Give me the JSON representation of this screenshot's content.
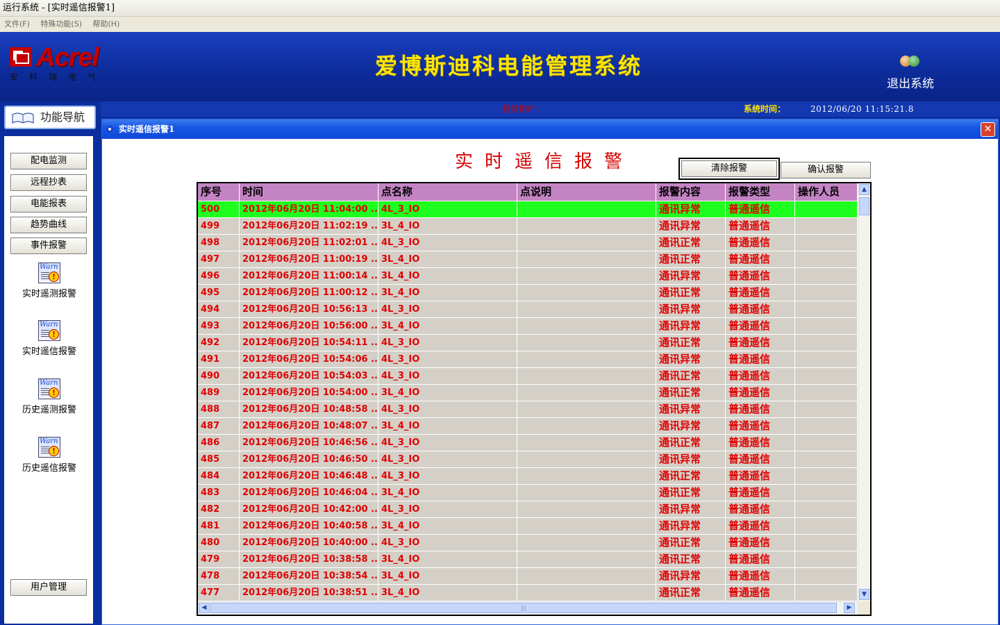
{
  "window": {
    "title": "运行系统 - [实时遥信报警1]"
  },
  "menu": [
    "文件(F)",
    "特殊功能(S)",
    "帮助(H)"
  ],
  "header": {
    "brand": "Acrel",
    "brand_sub": "安科瑞电气",
    "app_title": "爱博斯迪科电能管理系统",
    "exit_label": "退出系统"
  },
  "status": {
    "login_label": "登陆用户：",
    "systime_label": "系统时间：",
    "systime_value": "2012/06/20   11:15:21.8"
  },
  "nav": {
    "title": "功能导航",
    "buttons": [
      "配电监测",
      "远程抄表",
      "电能报表",
      "趋势曲线",
      "事件报警"
    ],
    "icons": [
      "实时遥测报警",
      "实时遥信报警",
      "历史遥测报警",
      "历史遥信报警"
    ],
    "user_mgmt": "用户管理"
  },
  "panel": {
    "title": "实时遥信报警1",
    "close": "✕",
    "heading": "实时遥信报警",
    "clear_button": "清除报警",
    "confirm_button": "确认报警"
  },
  "table": {
    "columns": [
      "序号",
      "时间",
      "点名称",
      "点说明",
      "报警内容",
      "报警类型",
      "操作人员"
    ],
    "rows": [
      [
        "500",
        "2012年06月20日 11:04:00 ...",
        "4L_3_IO",
        "",
        "通讯异常",
        "普通遥信",
        ""
      ],
      [
        "499",
        "2012年06月20日 11:02:19 ...",
        "3L_4_IO",
        "",
        "通讯异常",
        "普通遥信",
        ""
      ],
      [
        "498",
        "2012年06月20日 11:02:01 ...",
        "4L_3_IO",
        "",
        "通讯正常",
        "普通遥信",
        ""
      ],
      [
        "497",
        "2012年06月20日 11:00:19 ...",
        "3L_4_IO",
        "",
        "通讯正常",
        "普通遥信",
        ""
      ],
      [
        "496",
        "2012年06月20日 11:00:14 ...",
        "3L_4_IO",
        "",
        "通讯异常",
        "普通遥信",
        ""
      ],
      [
        "495",
        "2012年06月20日 11:00:12 ...",
        "3L_4_IO",
        "",
        "通讯正常",
        "普通遥信",
        ""
      ],
      [
        "494",
        "2012年06月20日 10:56:13 ...",
        "4L_3_IO",
        "",
        "通讯异常",
        "普通遥信",
        ""
      ],
      [
        "493",
        "2012年06月20日 10:56:00 ...",
        "3L_4_IO",
        "",
        "通讯异常",
        "普通遥信",
        ""
      ],
      [
        "492",
        "2012年06月20日 10:54:11 ...",
        "4L_3_IO",
        "",
        "通讯正常",
        "普通遥信",
        ""
      ],
      [
        "491",
        "2012年06月20日 10:54:06 ...",
        "4L_3_IO",
        "",
        "通讯异常",
        "普通遥信",
        ""
      ],
      [
        "490",
        "2012年06月20日 10:54:03 ...",
        "4L_3_IO",
        "",
        "通讯正常",
        "普通遥信",
        ""
      ],
      [
        "489",
        "2012年06月20日 10:54:00 ...",
        "3L_4_IO",
        "",
        "通讯正常",
        "普通遥信",
        ""
      ],
      [
        "488",
        "2012年06月20日 10:48:58 ...",
        "4L_3_IO",
        "",
        "通讯异常",
        "普通遥信",
        ""
      ],
      [
        "487",
        "2012年06月20日 10:48:07 ...",
        "3L_4_IO",
        "",
        "通讯异常",
        "普通遥信",
        ""
      ],
      [
        "486",
        "2012年06月20日 10:46:56 ...",
        "4L_3_IO",
        "",
        "通讯正常",
        "普通遥信",
        ""
      ],
      [
        "485",
        "2012年06月20日 10:46:50 ...",
        "4L_3_IO",
        "",
        "通讯异常",
        "普通遥信",
        ""
      ],
      [
        "484",
        "2012年06月20日 10:46:48 ...",
        "4L_3_IO",
        "",
        "通讯正常",
        "普通遥信",
        ""
      ],
      [
        "483",
        "2012年06月20日 10:46:04 ...",
        "3L_4_IO",
        "",
        "通讯正常",
        "普通遥信",
        ""
      ],
      [
        "482",
        "2012年06月20日 10:42:00 ...",
        "4L_3_IO",
        "",
        "通讯异常",
        "普通遥信",
        ""
      ],
      [
        "481",
        "2012年06月20日 10:40:58 ...",
        "3L_4_IO",
        "",
        "通讯异常",
        "普通遥信",
        ""
      ],
      [
        "480",
        "2012年06月20日 10:40:00 ...",
        "4L_3_IO",
        "",
        "通讯正常",
        "普通遥信",
        ""
      ],
      [
        "479",
        "2012年06月20日 10:38:58 ...",
        "3L_4_IO",
        "",
        "通讯正常",
        "普通遥信",
        ""
      ],
      [
        "478",
        "2012年06月20日 10:38:54 ...",
        "3L_4_IO",
        "",
        "通讯异常",
        "普通遥信",
        ""
      ],
      [
        "477",
        "2012年06月20日 10:38:51 ...",
        "3L_4_IO",
        "",
        "通讯正常",
        "普通遥信",
        ""
      ]
    ],
    "selected_row": 0
  },
  "colors": {
    "header_bg": "#0d2d9c",
    "title_yellow": "#ffe600",
    "alarm_red": "#e00000",
    "table_header": "#c484c4",
    "selected_row": "#1fff1f",
    "grid_bg": "#d4d0c8"
  }
}
